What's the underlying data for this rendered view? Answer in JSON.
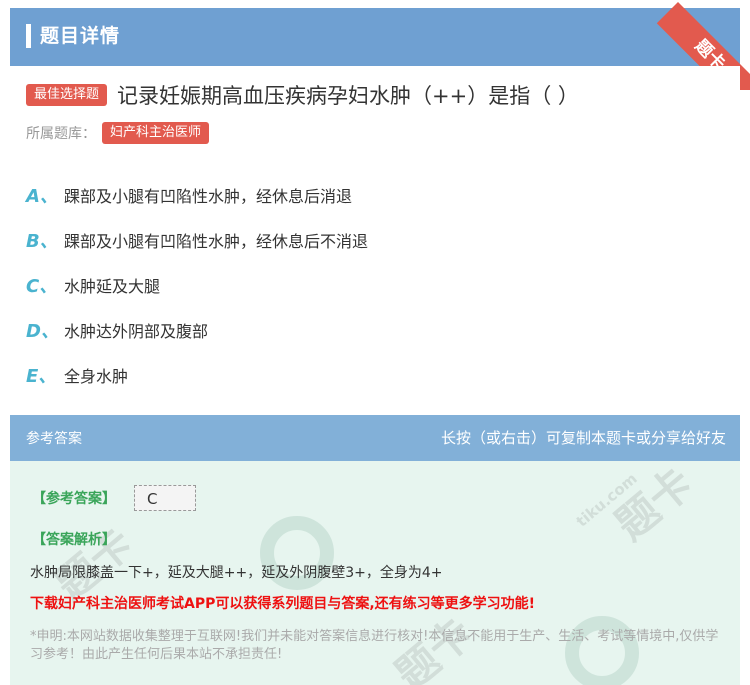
{
  "header": {
    "title": "题目详情",
    "ribbon": "题卡"
  },
  "question": {
    "badge": "最佳选择题",
    "text": "记录妊娠期高血压疾病孕妇水肿（++）是指（ ）",
    "category_label": "所属题库：",
    "category": "妇产科主治医师"
  },
  "options": [
    {
      "letter": "A、",
      "text": "踝部及小腿有凹陷性水肿，经休息后消退"
    },
    {
      "letter": "B、",
      "text": "踝部及小腿有凹陷性水肿，经休息后不消退"
    },
    {
      "letter": "C、",
      "text": "水肿延及大腿"
    },
    {
      "letter": "D、",
      "text": "水肿达外阴部及腹部"
    },
    {
      "letter": "E、",
      "text": "全身水肿"
    }
  ],
  "answer_section": {
    "title": "参考答案",
    "hint": "长按（或右击）可复制本题卡或分享给好友",
    "answer_label": "【参考答案】",
    "answer_value": "C",
    "analysis_label": "【答案解析】",
    "analysis_text": "水肿局限膝盖一下+，延及大腿++，延及外阴腹壁3+，全身为4+",
    "promo": "下载妇产科主治医师考试APP可以获得系列题目与答案,还有练习等更多学习功能!",
    "disclaimer": "*申明:本网站数据收集整理于互联网!我们并未能对答案信息进行核对!本信息不能用于生产、生活、考试等情境中,仅供学习参考！由此产生任何后果本站不承担责任!"
  },
  "watermark": {
    "text": "题卡",
    "site": "tiku.com"
  }
}
